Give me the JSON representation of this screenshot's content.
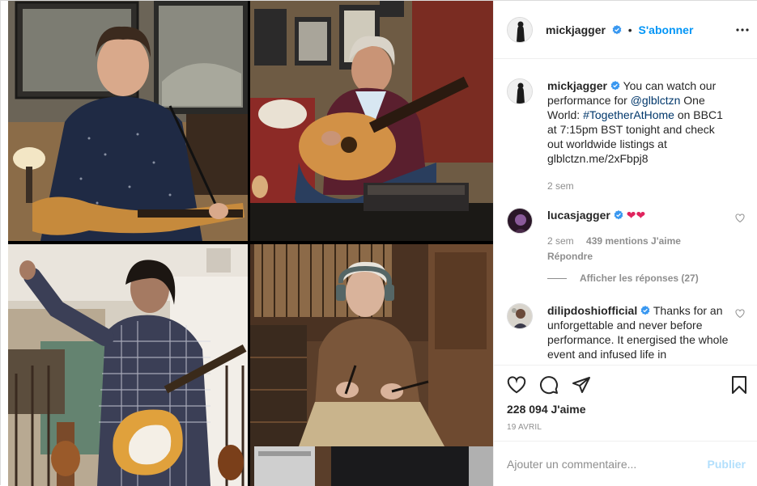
{
  "header": {
    "username": "mickjagger",
    "separator": "•",
    "follow_label": "S'abonner"
  },
  "caption": {
    "username": "mickjagger",
    "text_1": "You can watch our performance for ",
    "mention": "@glblctzn",
    "text_2": " One World: ",
    "hashtag": "#TogetherAtHome",
    "text_3": " on BBC1 at 7:15pm BST tonight and check out worldwide listings at glblctzn.me/2xFbpj8",
    "time": "2 sem"
  },
  "comments": [
    {
      "username": "lucasjagger",
      "text": "❤❤",
      "time": "2 sem",
      "likes": "439 mentions J'aime",
      "reply_label": "Répondre",
      "view_replies": "Afficher les réponses (27)"
    },
    {
      "username": "dilipdoshiofficial",
      "text": "Thanks for an unforgettable and never before performance. It energised the whole event and infused life in"
    }
  ],
  "actions": {
    "likes": "228 094 J'aime",
    "date": "19 AVRIL"
  },
  "add_comment": {
    "placeholder": "Ajouter un commentaire...",
    "publish_label": "Publier"
  },
  "colors": {
    "link": "#00376b",
    "follow": "#0095f6",
    "verified": "#3897f0",
    "heart": "#ed4956"
  },
  "icons": [
    "verified-badge-icon",
    "more-options-icon",
    "heart-icon",
    "comment-icon",
    "share-icon",
    "bookmark-icon"
  ]
}
